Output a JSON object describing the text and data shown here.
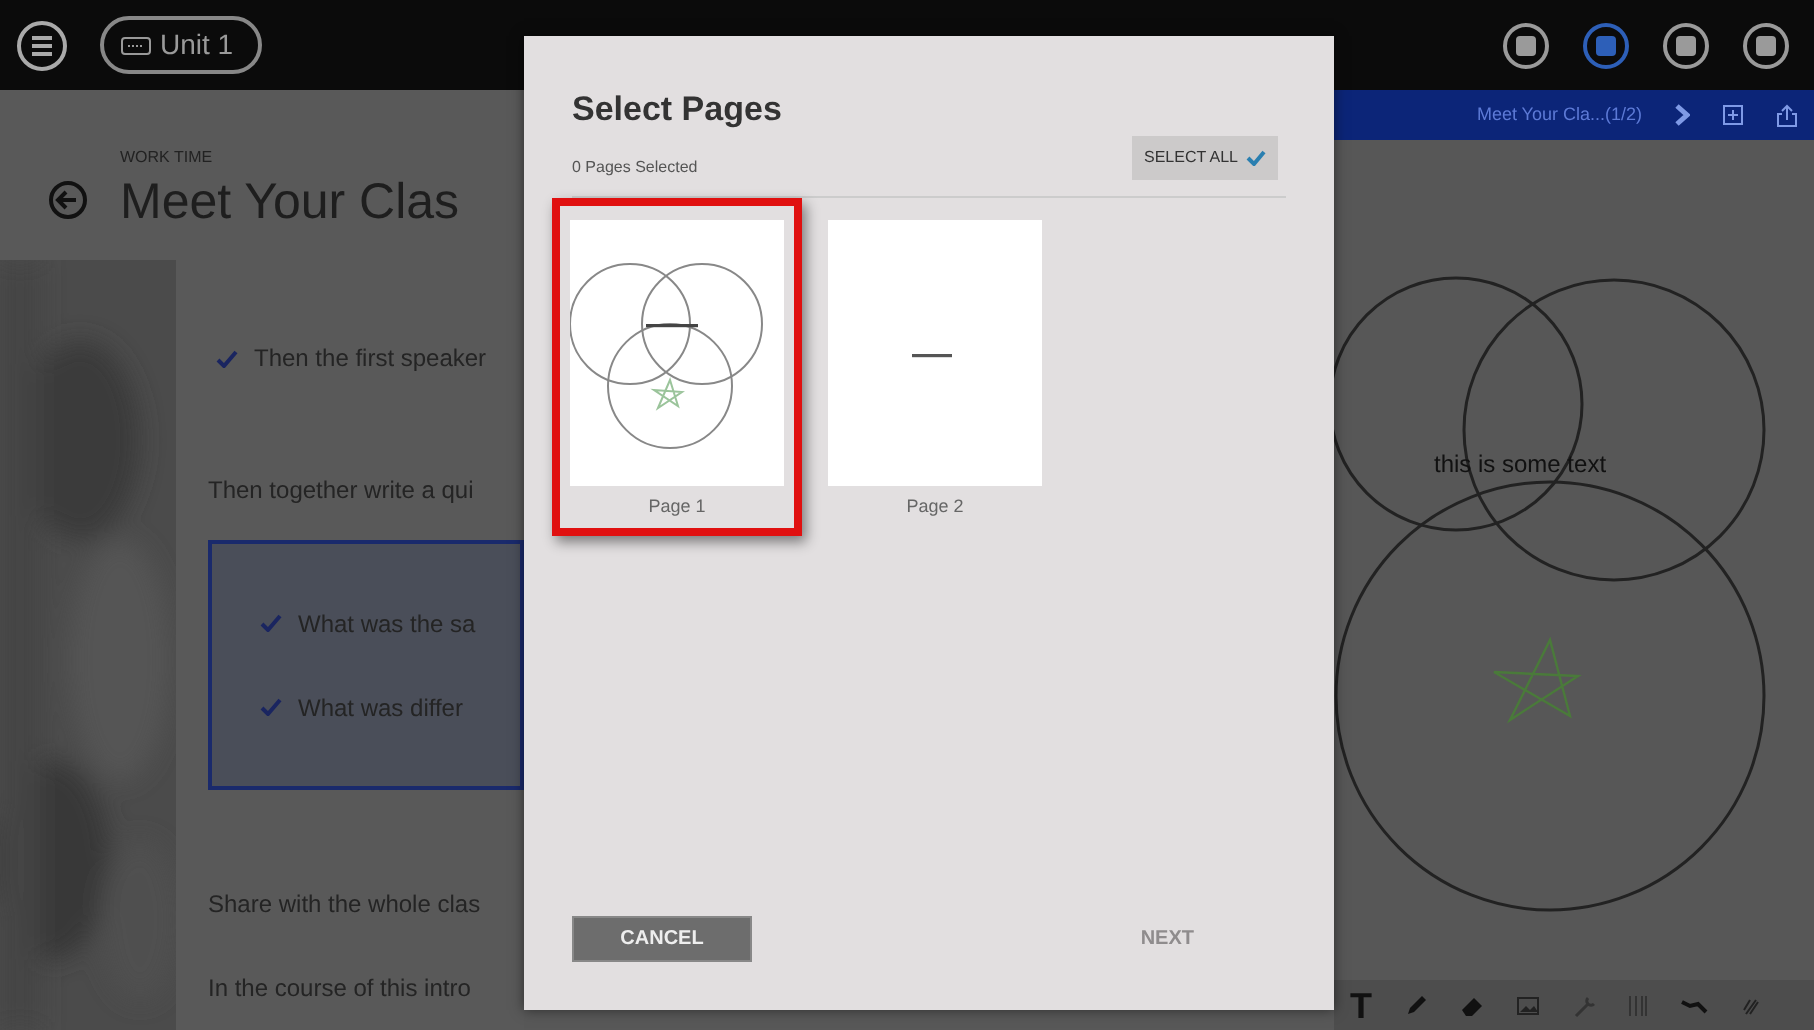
{
  "top_bar": {
    "unit_label": "Unit 1",
    "apps": [
      {
        "selected": false
      },
      {
        "selected": true
      },
      {
        "selected": false
      },
      {
        "selected": false
      }
    ]
  },
  "lesson": {
    "section": "WORK TIME",
    "title": "Meet Your Clas",
    "blocks": [
      {
        "kind": "check",
        "text": "Then the first speaker"
      },
      {
        "kind": "para",
        "text": "Then together write a qui"
      },
      {
        "kind": "box",
        "items": [
          "What was the sa",
          "What was differ"
        ]
      },
      {
        "kind": "para",
        "text": "Share with the whole clas"
      },
      {
        "kind": "para",
        "text": "In the course of this intro"
      }
    ]
  },
  "viewer": {
    "title": "Meet Your Cla...(1/2)",
    "canvas_text": "this is some text",
    "text_tool": "T"
  },
  "dialog": {
    "title": "Select Pages",
    "subtitle": "0 Pages Selected",
    "select_all": "SELECT ALL",
    "pages": [
      {
        "label": "Page 1",
        "kind": "venn",
        "highlighted": true
      },
      {
        "label": "Page 2",
        "kind": "text",
        "highlighted": false
      }
    ],
    "cancel": "CANCEL",
    "next": {
      "label": "NEXT",
      "disabled": true
    }
  }
}
